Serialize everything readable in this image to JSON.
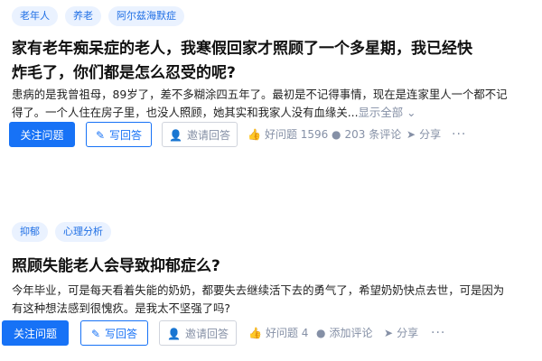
{
  "questions": [
    {
      "tags": [
        "老年人",
        "养老",
        "阿尔兹海默症"
      ],
      "title_line1": "家有老年痴呆症的老人，我寒假回家才照顾了一个多星期，我已经快",
      "title_line2": "炸毛了，你们都是怎么忍受的呢?",
      "excerpt_line1": "患病的是我曾祖母，89岁了，差不多糊涂四五年了。最初是不记得事情，现在是连家里人一个都不记",
      "excerpt_line2": "得了。一个人住在房子里，也没人照顾，她其实和我家人没有血缘关...",
      "expand_label": "显示全部",
      "follow_label": "关注问题",
      "answer_label": "写回答",
      "invite_label": "邀请回答",
      "good_question_label": "好问题 1596",
      "comments_label": "203 条评论",
      "share_label": "分享",
      "more_label": "···"
    },
    {
      "tags": [
        "抑郁",
        "心理分析"
      ],
      "title_line1": "照顾失能老人会导致抑郁症么?",
      "title_line2": "",
      "excerpt_line1": "今年毕业，可是每天看着失能的奶奶，都要失去继续活下去的勇气了，希望奶奶快点去世，可是因为",
      "excerpt_line2": "有这种想法感到很愧疚。是我太不坚强了吗?",
      "expand_label": "",
      "follow_label": "关注问题",
      "answer_label": "写回答",
      "invite_label": "邀请回答",
      "good_question_label": "好问题 4",
      "comments_label": "添加评论",
      "share_label": "分享",
      "more_label": "···"
    }
  ],
  "colors": {
    "brand": "#1772f6",
    "tag_bg": "#eaf2ff",
    "tag_text": "#1f6fe5",
    "meta_gray": "#8590a6"
  },
  "icons": {
    "answer": "pencil-icon",
    "invite": "add-user-icon",
    "good_question": "thumbs-up-icon",
    "comments": "comment-bubble-icon",
    "share": "paper-plane-icon",
    "expand": "chevron-down-icon"
  }
}
